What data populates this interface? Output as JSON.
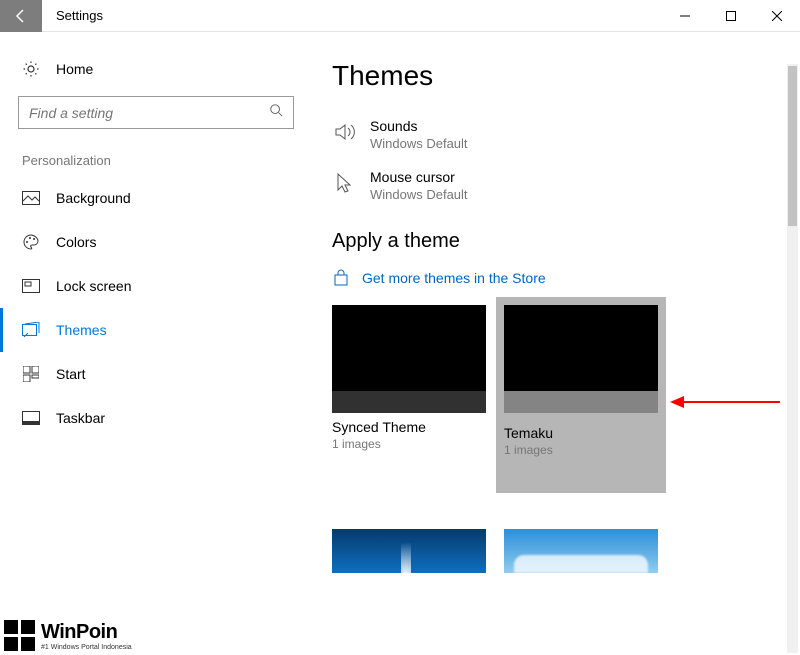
{
  "window": {
    "title": "Settings"
  },
  "sidebar": {
    "home": "Home",
    "search_placeholder": "Find a setting",
    "section": "Personalization",
    "items": [
      {
        "label": "Background"
      },
      {
        "label": "Colors"
      },
      {
        "label": "Lock screen"
      },
      {
        "label": "Themes"
      },
      {
        "label": "Start"
      },
      {
        "label": "Taskbar"
      }
    ]
  },
  "main": {
    "title": "Themes",
    "sounds": {
      "label": "Sounds",
      "value": "Windows Default"
    },
    "cursor": {
      "label": "Mouse cursor",
      "value": "Windows Default"
    },
    "apply_title": "Apply a theme",
    "store_link": "Get more themes in the Store",
    "themes": [
      {
        "name": "Synced Theme",
        "sub": "1 images"
      },
      {
        "name": "Temaku",
        "sub": "1 images"
      }
    ]
  },
  "watermark": {
    "name": "WinPoin",
    "tagline": "#1 Windows Portal Indonesia"
  }
}
